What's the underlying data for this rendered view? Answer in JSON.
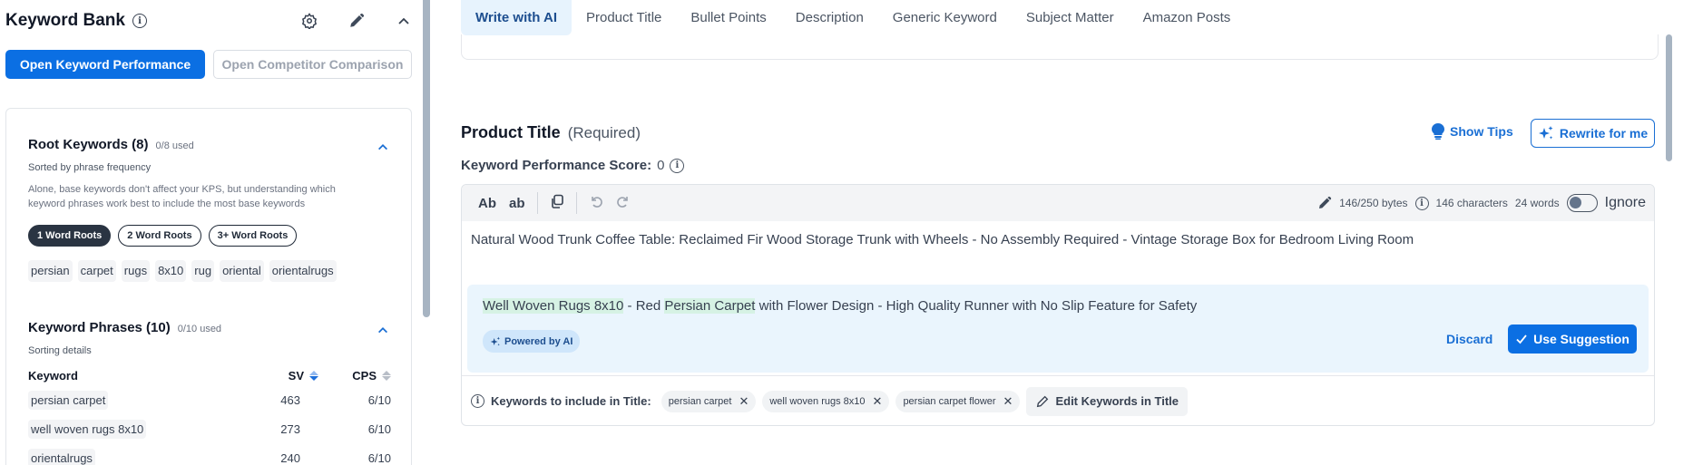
{
  "keyword_bank": {
    "title": "Keyword Bank",
    "open_kp_label": "Open Keyword Performance",
    "open_cc_label": "Open Competitor Comparison",
    "root": {
      "title": "Root Keywords (8)",
      "used": "0/8 used",
      "sorted": "Sorted by phrase frequency",
      "description": "Alone, base keywords don't affect your KPS, but understanding which keyword phrases work best to include the most base keywords",
      "filters": [
        "1 Word Roots",
        "2 Word Roots",
        "3+ Word Roots"
      ],
      "active_filter": "1 Word Roots",
      "chips": [
        "persian",
        "carpet",
        "rugs",
        "8x10",
        "rug",
        "oriental",
        "orientalrugs"
      ]
    },
    "phrases": {
      "title": "Keyword Phrases (10)",
      "used": "0/10 used",
      "sorting": "Sorting details",
      "columns": [
        "Keyword",
        "SV",
        "CPS"
      ],
      "rows": [
        {
          "keyword": "persian carpet",
          "sv": "463",
          "cps": "6/10"
        },
        {
          "keyword": "well woven rugs 8x10",
          "sv": "273",
          "cps": "6/10"
        },
        {
          "keyword": "orientalrugs",
          "sv": "240",
          "cps": "6/10"
        }
      ]
    }
  },
  "tabs": [
    "Write with AI",
    "Product Title",
    "Bullet Points",
    "Description",
    "Generic Keyword",
    "Subject Matter",
    "Amazon Posts"
  ],
  "active_tab": "Write with AI",
  "product_title": {
    "title": "Product Title",
    "required": "(Required)",
    "kps_label": "Keyword Performance Score:",
    "kps_value": "0",
    "show_tips": "Show Tips",
    "rewrite": "Rewrite for me",
    "toolbar": {
      "ab_upper": "Ab",
      "ab_lower": "ab",
      "bytes": "146/250 bytes",
      "characters": "146 characters",
      "words": "24 words",
      "ignore": "Ignore",
      "ignore_on": false
    },
    "current_text": "Natural Wood Trunk Coffee Table: Reclaimed Fir Wood Storage Trunk with Wheels - No Assembly Required - Vintage Storage Box for Bedroom Living Room",
    "suggestion": {
      "parts": [
        {
          "text": "Well Woven Rugs 8x10",
          "highlight": true
        },
        {
          "text": " - Red ",
          "highlight": false
        },
        {
          "text": "Persian Carpet",
          "highlight": true
        },
        {
          "text": " with Flower Design - High Quality Runner with No Slip Feature for Safety",
          "highlight": false
        }
      ],
      "powered_by": "Powered by AI",
      "discard": "Discard",
      "use": "Use Suggestion"
    },
    "keywords_label": "Keywords to include in Title:",
    "keywords": [
      "persian carpet",
      "well woven rugs 8x10",
      "persian carpet flower"
    ],
    "edit_keywords": "Edit Keywords in Title"
  },
  "colors": {
    "primary": "#0b6fe3",
    "link": "#1a6fd4",
    "highlight": "#d6f2e4",
    "suggestion_bg": "#eaf5fd"
  }
}
